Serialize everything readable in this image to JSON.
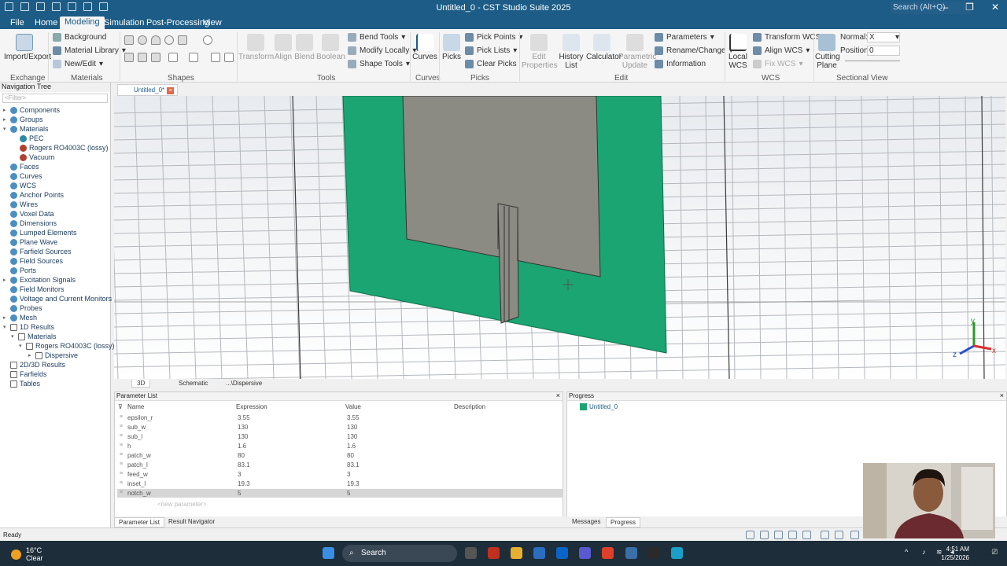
{
  "titlebar": {
    "title": "Untitled_0 - CST Studio Suite 2025",
    "search": "Search (Alt+Q)"
  },
  "menu": [
    "File",
    "Home",
    "Modeling",
    "Simulation",
    "Post-Processing",
    "View"
  ],
  "ribbon": {
    "import_export": "Import/Export",
    "background": "Background",
    "material_library": "Material Library",
    "new_edit": "New/Edit",
    "transform": "Transform",
    "align": "Align",
    "blend": "Blend",
    "boolean": "Boolean",
    "bend_tools": "Bend Tools",
    "modify_locally": "Modify Locally",
    "shape_tools": "Shape Tools",
    "curves": "Curves",
    "picks": "Picks",
    "pick_points": "Pick Points",
    "pick_lists": "Pick Lists",
    "clear_picks": "Clear Picks",
    "edit_properties": "Edit Properties",
    "history_list": "History List",
    "calculator": "Calculator",
    "parametric_update": "Parametric Update",
    "parameters": "Parameters",
    "rename_change": "Rename/Change",
    "information": "Information",
    "local_wcs": "Local WCS",
    "transform_wcs": "Transform WCS",
    "align_wcs": "Align WCS",
    "fix_wcs": "Fix WCS",
    "cutting_plane": "Cutting Plane",
    "normal_label": "Normal:",
    "normal_value": "X",
    "position_label": "Position:",
    "position_value": "0",
    "groups": [
      "Exchange",
      "Materials",
      "Shapes",
      "Tools",
      "Curves",
      "Picks",
      "Edit",
      "WCS",
      "Sectional View"
    ]
  },
  "navtree": {
    "title": "Navigation Tree",
    "filter": "<Filter>",
    "items": [
      "Components",
      "Groups",
      "Materials",
      "PEC",
      "Rogers RO4003C (lossy)",
      "Vacuum",
      "Faces",
      "Curves",
      "WCS",
      "Anchor Points",
      "Wires",
      "Voxel Data",
      "Dimensions",
      "Lumped Elements",
      "Plane Wave",
      "Farfield Sources",
      "Field Sources",
      "Ports",
      "Excitation Signals",
      "Field Monitors",
      "Voltage and Current Monitors",
      "Probes",
      "Mesh",
      "1D Results",
      "Materials",
      "Rogers RO4003C (lossy)",
      "Dispersive",
      "2D/3D Results",
      "Farfields",
      "Tables"
    ]
  },
  "doc_tab": "Untitled_0*",
  "view_tabs": [
    "3D",
    "Schematic",
    "...\\Dispersive"
  ],
  "params": {
    "title": "Parameter List",
    "cols": [
      "Name",
      "Expression",
      "Value",
      "Description"
    ],
    "rows": [
      {
        "name": "epsilon_r",
        "expr": "3.55",
        "value": "3.55"
      },
      {
        "name": "sub_w",
        "expr": "130",
        "value": "130"
      },
      {
        "name": "sub_l",
        "expr": "130",
        "value": "130"
      },
      {
        "name": "h",
        "expr": "1.6",
        "value": "1.6"
      },
      {
        "name": "patch_w",
        "expr": "80",
        "value": "80"
      },
      {
        "name": "patch_l",
        "expr": "83.1",
        "value": "83.1"
      },
      {
        "name": "feed_w",
        "expr": "3",
        "value": "3"
      },
      {
        "name": "inset_l",
        "expr": "19.3",
        "value": "19.3"
      },
      {
        "name": "notch_w",
        "expr": "5",
        "value": "5"
      }
    ],
    "new_param": "<new parameter>"
  },
  "progress": {
    "title": "Progress",
    "item": "Untitled_0"
  },
  "bottom_tabs": {
    "param_list": "Parameter List",
    "result_nav": "Result Navigator",
    "messages": "Messages",
    "progress": "Progress"
  },
  "status": "Ready",
  "taskbar": {
    "temp": "16°C",
    "cond": "Clear",
    "search": "Search",
    "time": "4:51 AM",
    "date": "1/25/2026"
  },
  "axes": {
    "x": "x",
    "y": "y",
    "z": "z"
  },
  "colors": {
    "accent": "#1c5c86",
    "substrate": "#1aa572",
    "patch": "#8b8b84"
  }
}
